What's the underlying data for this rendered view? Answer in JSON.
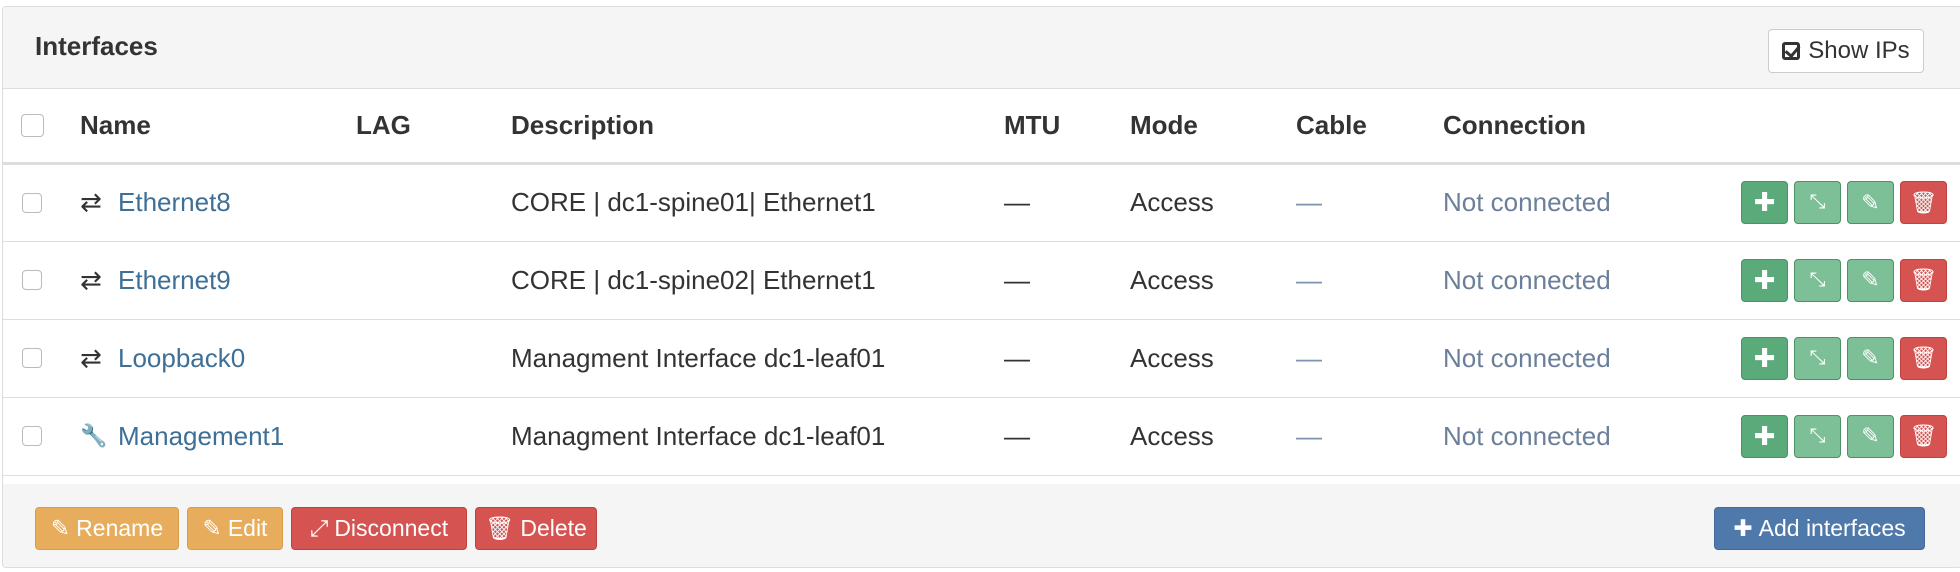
{
  "panel": {
    "title": "Interfaces",
    "show_ips_label": "Show IPs"
  },
  "columns": {
    "name": "Name",
    "lag": "LAG",
    "description": "Description",
    "mtu": "MTU",
    "mode": "Mode",
    "cable": "Cable",
    "connection": "Connection"
  },
  "rows": [
    {
      "icon": "⇄",
      "icon_name": "arrows-exchange-icon",
      "name": "Ethernet8",
      "lag": "",
      "description": "CORE | dc1-spine01| Ethernet1",
      "mtu": "—",
      "mode": "Access",
      "cable": "—",
      "connection": "Not connected"
    },
    {
      "icon": "⇄",
      "icon_name": "arrows-exchange-icon",
      "name": "Ethernet9",
      "lag": "",
      "description": "CORE | dc1-spine02| Ethernet1",
      "mtu": "—",
      "mode": "Access",
      "cable": "—",
      "connection": "Not connected"
    },
    {
      "icon": "⇄",
      "icon_name": "arrows-exchange-icon",
      "name": "Loopback0",
      "lag": "",
      "description": "Managment Interface dc1-leaf01",
      "mtu": "—",
      "mode": "Access",
      "cable": "—",
      "connection": "Not connected"
    },
    {
      "icon": "🔧",
      "icon_name": "wrench-icon",
      "name": "Management1",
      "lag": "",
      "description": "Managment Interface dc1-leaf01",
      "mtu": "—",
      "mode": "Access",
      "cable": "—",
      "connection": "Not connected"
    }
  ],
  "footer": {
    "rename_label": "Rename",
    "edit_label": "Edit",
    "disconnect_label": "Disconnect",
    "delete_label": "Delete",
    "add_label": "Add interfaces"
  },
  "colors": {
    "link": "#3e6f96",
    "green": "#5aaa7a",
    "red": "#d55451",
    "orange": "#e7ad5d",
    "blue": "#4f79aa"
  }
}
